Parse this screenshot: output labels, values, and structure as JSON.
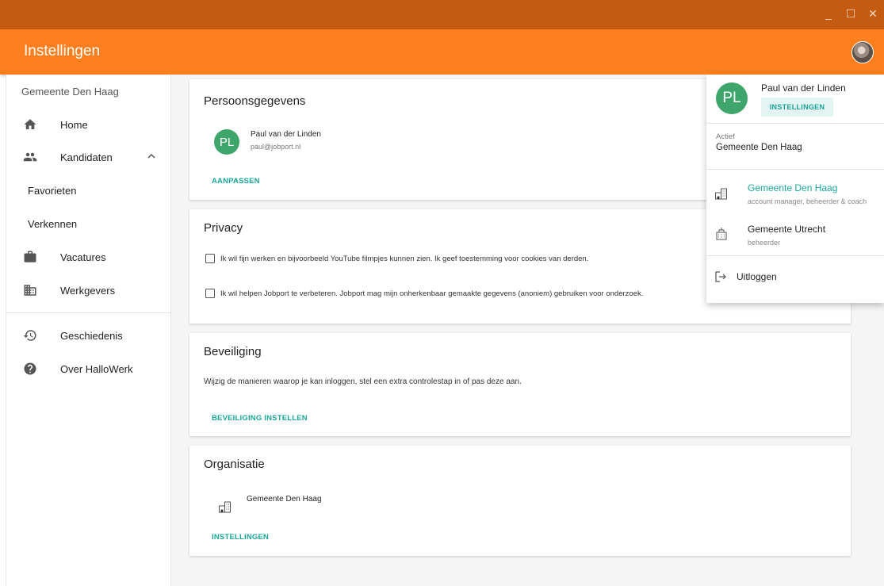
{
  "window": {
    "controls": [
      "_",
      "☐",
      "✕"
    ]
  },
  "header": {
    "title": "Instellingen"
  },
  "sidebar": {
    "org": "Gemeente Den Haag",
    "items": [
      {
        "label": "Home",
        "icon": "home-icon"
      },
      {
        "label": "Kandidaten",
        "icon": "people-icon",
        "expanded": true
      },
      {
        "label": "Favorieten",
        "sub": true
      },
      {
        "label": "Verkennen",
        "sub": true
      },
      {
        "label": "Vacatures",
        "icon": "briefcase-icon"
      },
      {
        "label": "Werkgevers",
        "icon": "building-icon"
      },
      {
        "label": "Geschiedenis",
        "icon": "history-icon"
      },
      {
        "label": "Over HalloWerk",
        "icon": "help-icon"
      }
    ]
  },
  "cards": {
    "personal": {
      "title": "Persoonsgegevens",
      "initials": "PL",
      "name": "Paul van der Linden",
      "email": "paul@jobport.nl",
      "action": "AANPASSEN"
    },
    "privacy": {
      "title": "Privacy",
      "options": [
        "Ik wil fijn werken en bijvoorbeeld YouTube filmpjes kunnen zien. Ik geef toestemming voor cookies van derden.",
        "Ik wil helpen Jobport te verbeteren. Jobport mag mijn onherkenbaar gemaakte gegevens (anoniem) gebruiken voor onderzoek."
      ]
    },
    "security": {
      "title": "Beveiliging",
      "text": "Wijzig de manieren waarop je kan inloggen, stel een extra controlestap in of pas deze aan.",
      "action": "BEVEILIGING INSTELLEN"
    },
    "organisation": {
      "title": "Organisatie",
      "name": "Gemeente Den Haag",
      "action": "INSTELLINGEN"
    }
  },
  "account_menu": {
    "initials": "PL",
    "name": "Paul van der Linden",
    "settings_button": "INSTELLINGEN",
    "active_label": "Actief",
    "active_org": "Gemeente Den Haag",
    "orgs": [
      {
        "name": "Gemeente Den Haag",
        "roles": "account manager, beheerder & coach",
        "selected": true
      },
      {
        "name": "Gemeente Utrecht",
        "roles": "beheerder",
        "selected": false
      }
    ],
    "logout": "Uitloggen"
  },
  "colors": {
    "titlebar": "#c55a11",
    "appbar": "#ff7f1e",
    "accent": "#1aa79a",
    "avatar": "#3fa66b"
  }
}
